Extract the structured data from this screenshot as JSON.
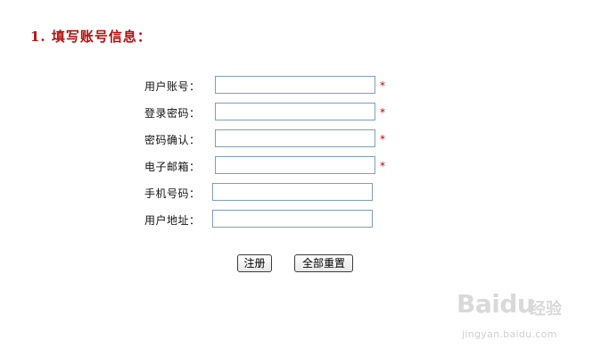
{
  "section": {
    "title": "1. 填写账号信息："
  },
  "form": {
    "required_mark": "*",
    "fields": [
      {
        "label": "用户账号：",
        "value": "",
        "required": true
      },
      {
        "label": "登录密码：",
        "value": "",
        "required": true
      },
      {
        "label": "密码确认：",
        "value": "",
        "required": true
      },
      {
        "label": "电子邮箱：",
        "value": "",
        "required": true
      },
      {
        "label": "手机号码：",
        "value": "",
        "required": false
      },
      {
        "label": "用户地址：",
        "value": "",
        "required": false
      }
    ],
    "buttons": {
      "register": "注册",
      "reset": "全部重置"
    }
  },
  "watermark": {
    "logo": "Baidu",
    "product": "经验",
    "url": "jingyan.baidu.com"
  }
}
